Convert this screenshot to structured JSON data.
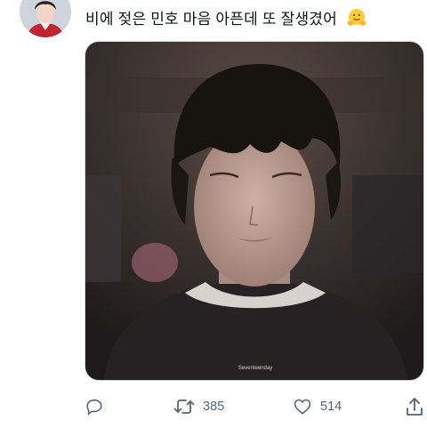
{
  "tweet": {
    "text": "비에 젖은 민호 마음 아픈데 또 잘생겼어",
    "emoji": "hugging-face-emoji"
  },
  "media": {
    "watermark": "Seventeenday"
  },
  "actions": {
    "reply_icon": "reply-icon",
    "retweet_icon": "retweet-icon",
    "retweet_count": "385",
    "like_icon": "heart-icon",
    "like_count": "514",
    "share_icon": "share-icon"
  },
  "colors": {
    "text": "#0f1419",
    "muted": "#536471",
    "border": "#cfd9de"
  }
}
